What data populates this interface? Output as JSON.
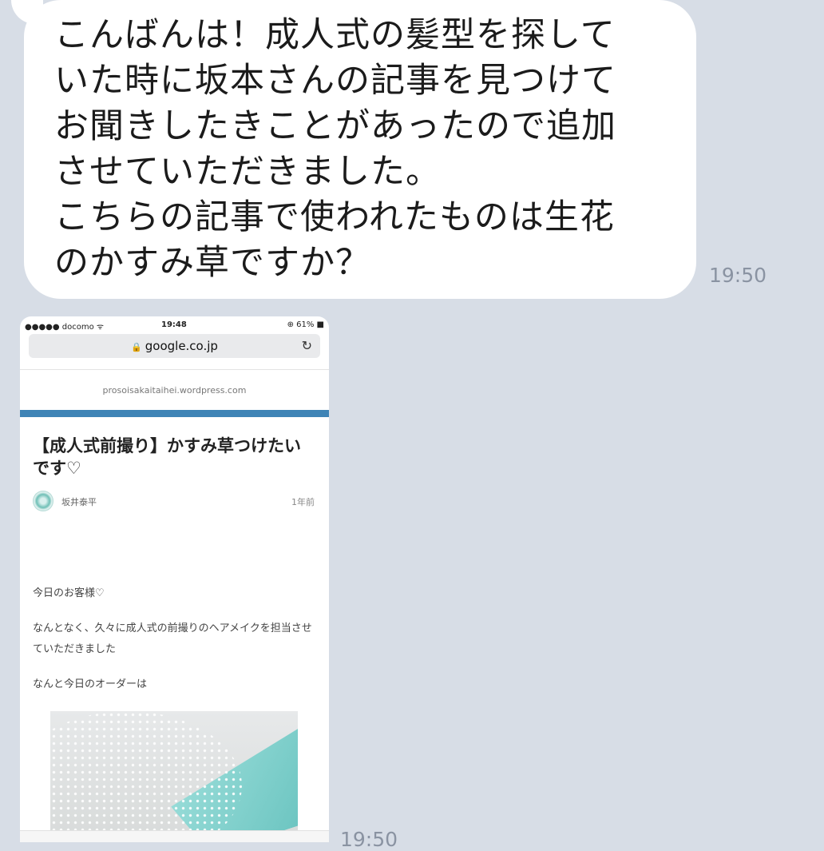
{
  "message": {
    "text": "こんばんは！成人式の髪型を探して\nいた時に坂本さんの記事を見つけて\nお聞きしたきことがあったので追加\nさせていただきました。\nこちらの記事で使われたものは生花\nのかすみ草ですか？",
    "time": "19:50"
  },
  "screenshot": {
    "status": {
      "carrier": "●●●●● docomo ᯤ",
      "time": "19:48",
      "battery": "⊕ 61% ■"
    },
    "url": "google.co.jp",
    "site": "prosoisakaitaihei.wordpress.com",
    "title": "【成人式前撮り】かすみ草つけたいです♡",
    "author": "坂井泰平",
    "posted": "1年前",
    "paragraphs": [
      "今日のお客様♡",
      "なんとなく、久々に成人式の前撮りのヘアメイクを担当させていただきました",
      "なんと今日のオーダーは"
    ],
    "time": "19:50",
    "icons": {
      "lock": "lock-icon",
      "reload": "reload-icon"
    }
  }
}
